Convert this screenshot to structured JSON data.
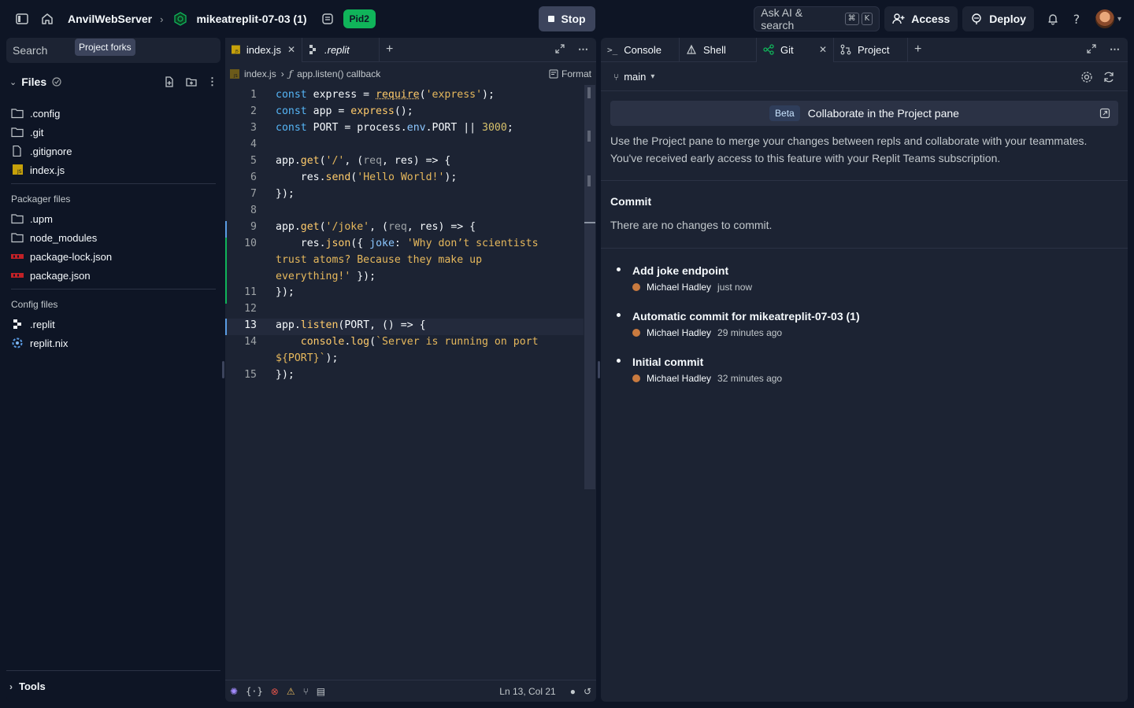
{
  "topbar": {
    "workspace": "AnvilWebServer",
    "repl": "mikeatreplit-07-03 (1)",
    "pid_badge": "Pid2",
    "stop_label": "Stop",
    "ask_ai": "Ask AI & search",
    "kbd1": "⌘",
    "kbd2": "K",
    "access_label": "Access",
    "deploy_label": "Deploy"
  },
  "sidebar": {
    "search_placeholder": "Search",
    "tooltip": "Project forks",
    "files_title": "Files",
    "files": [
      ".config",
      ".git",
      ".gitignore",
      "index.js"
    ],
    "packager_label": "Packager files",
    "packager": [
      ".upm",
      "node_modules",
      "package-lock.json",
      "package.json"
    ],
    "config_label": "Config files",
    "config": [
      ".replit",
      "replit.nix"
    ],
    "tools_label": "Tools"
  },
  "editor": {
    "tabs": [
      "index.js",
      ".replit"
    ],
    "breadcrumb_file": "index.js",
    "breadcrumb_fn": "app.listen() callback",
    "format_label": "Format",
    "line_numbers": [
      "1",
      "2",
      "3",
      "4",
      "5",
      "6",
      "7",
      "8",
      "9",
      "10",
      "11",
      "12",
      "13",
      "14",
      "15"
    ],
    "status_lncol": "Ln 13, Col 21"
  },
  "right": {
    "tabs": [
      "Console",
      "Shell",
      "Git",
      "Project"
    ],
    "branch": "main",
    "beta_tag": "Beta",
    "beta_text": "Collaborate in the Project pane",
    "info": "Use the Project pane to merge your changes between repls and collaborate with your teammates. You've received early access to this feature with your Replit Teams subscription.",
    "commit_title": "Commit",
    "commit_empty": "There are no changes to commit.",
    "commits": [
      {
        "message": "Add joke endpoint",
        "author": "Michael Hadley",
        "time": "just now"
      },
      {
        "message": "Automatic commit for mikeatreplit-07-03 (1)",
        "author": "Michael Hadley",
        "time": "29 minutes ago"
      },
      {
        "message": "Initial commit",
        "author": "Michael Hadley",
        "time": "32 minutes ago"
      }
    ]
  },
  "colors": {
    "background": "#0e1525",
    "panel": "#1c2333",
    "accent_green": "#10b45a",
    "keyword": "#56b6f7",
    "string": "#e6b85c"
  }
}
